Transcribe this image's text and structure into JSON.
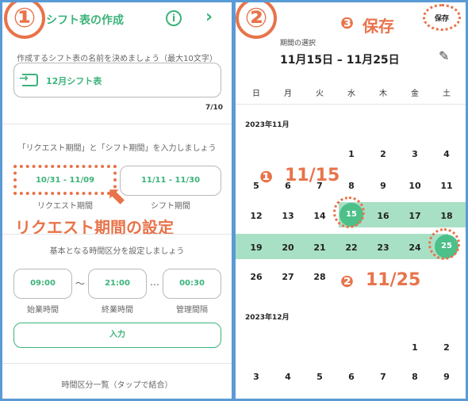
{
  "left": {
    "step_marker": "①",
    "header_title": "シフト表の作成",
    "name_prompt": "作成するシフト表の名前を決めましょう（最大10文字）",
    "name_value": "12月シフト表",
    "char_count": "7/10",
    "period_prompt": "「リクエスト期間」と「シフト期間」を入力しましょう",
    "request_period_value": "10/31 - 11/09",
    "request_period_label": "リクエスト期間",
    "shift_period_value": "11/11 - 11/30",
    "shift_period_label": "シフト期間",
    "annotation": "リクエスト期間の設定",
    "time_prompt": "基本となる時間区分を設定しましょう",
    "start_time_value": "09:00",
    "start_time_label": "始業時間",
    "time_separator": "～",
    "end_time_value": "21:00",
    "end_time_label": "終業時間",
    "interval_separator": "…",
    "interval_value": "00:30",
    "interval_label": "管理間隔",
    "submit_label": "入力",
    "list_title": "時間区分一覧（タップで結合）"
  },
  "right": {
    "step_marker": "②",
    "save_annotation_num": "❸",
    "save_annotation_text": "保存",
    "save_button_label": "保存",
    "period_caption": "期間の選択",
    "period_range": "11月15日 – 11月25日",
    "weekdays": [
      "日",
      "月",
      "火",
      "水",
      "木",
      "金",
      "土"
    ],
    "month1_label": "2023年11月",
    "month1_rows": [
      [
        "",
        "",
        "",
        "1",
        "2",
        "3",
        "4"
      ],
      [
        "5",
        "6",
        "7",
        "8",
        "9",
        "10",
        "11"
      ],
      [
        "12",
        "13",
        "14",
        "15",
        "16",
        "17",
        "18"
      ],
      [
        "19",
        "20",
        "21",
        "22",
        "23",
        "24",
        "25"
      ],
      [
        "26",
        "27",
        "28",
        "",
        "",
        "",
        ""
      ]
    ],
    "annotation_start_num": "❶",
    "annotation_start_text": "11/15",
    "annotation_end_num": "❷",
    "annotation_end_text": "11/25",
    "month2_label": "2023年12月",
    "month2_rows": [
      [
        "",
        "",
        "",
        "",
        "",
        "1",
        "2"
      ],
      [
        "3",
        "4",
        "5",
        "6",
        "7",
        "8",
        "9"
      ]
    ]
  },
  "colors": {
    "accent_green": "#3cb37a",
    "highlight": "#a8e0c6",
    "annotation": "#e8734a",
    "frame": "#5b9bd5"
  }
}
